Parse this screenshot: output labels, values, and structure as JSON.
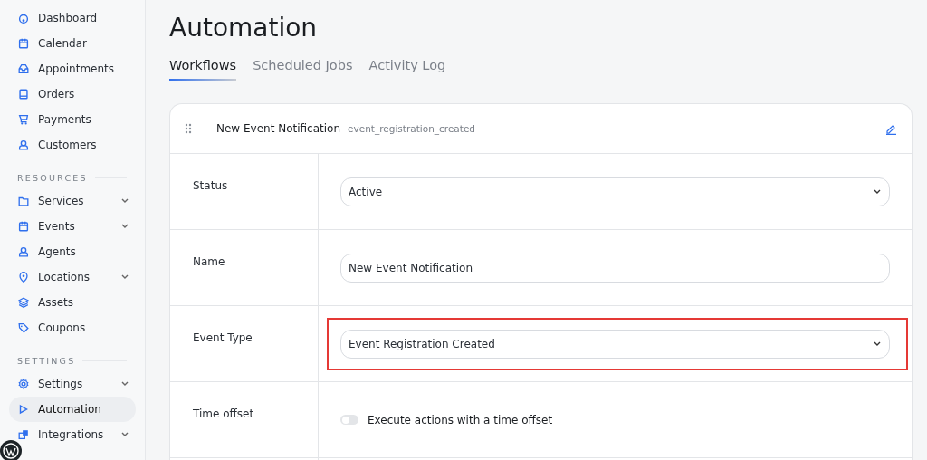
{
  "sidebar": {
    "sections": [
      {
        "items": [
          {
            "label": "Dashboard",
            "expandable": false,
            "selected": false
          },
          {
            "label": "Calendar",
            "expandable": false,
            "selected": false
          },
          {
            "label": "Appointments",
            "expandable": false,
            "selected": false
          },
          {
            "label": "Orders",
            "expandable": false,
            "selected": false
          },
          {
            "label": "Payments",
            "expandable": false,
            "selected": false
          },
          {
            "label": "Customers",
            "expandable": false,
            "selected": false
          }
        ]
      },
      {
        "heading": "RESOURCES",
        "items": [
          {
            "label": "Services",
            "expandable": true,
            "selected": false
          },
          {
            "label": "Events",
            "expandable": true,
            "selected": false
          },
          {
            "label": "Agents",
            "expandable": false,
            "selected": false
          },
          {
            "label": "Locations",
            "expandable": true,
            "selected": false
          },
          {
            "label": "Assets",
            "expandable": false,
            "selected": false
          },
          {
            "label": "Coupons",
            "expandable": false,
            "selected": false
          }
        ]
      },
      {
        "heading": "SETTINGS",
        "items": [
          {
            "label": "Settings",
            "expandable": true,
            "selected": false
          },
          {
            "label": "Automation",
            "expandable": false,
            "selected": true
          },
          {
            "label": "Integrations",
            "expandable": true,
            "selected": false
          }
        ]
      }
    ]
  },
  "page": {
    "title": "Automation"
  },
  "tabs": [
    {
      "label": "Workflows",
      "selected": true
    },
    {
      "label": "Scheduled Jobs",
      "selected": false
    },
    {
      "label": "Activity Log",
      "selected": false
    }
  ],
  "workflow": {
    "name": "New Event Notification",
    "trigger_key": "event_registration_created",
    "fields": [
      {
        "label": "Status",
        "kind": "select",
        "value": "Active",
        "highlighted": false
      },
      {
        "label": "Name",
        "kind": "text",
        "value": "New Event Notification",
        "highlighted": false
      },
      {
        "label": "Event Type",
        "kind": "select",
        "value": "Event Registration Created",
        "highlighted": true
      },
      {
        "label": "Time offset",
        "kind": "toggle",
        "text": "Execute actions with a time offset",
        "on": false,
        "highlighted": false
      }
    ]
  }
}
